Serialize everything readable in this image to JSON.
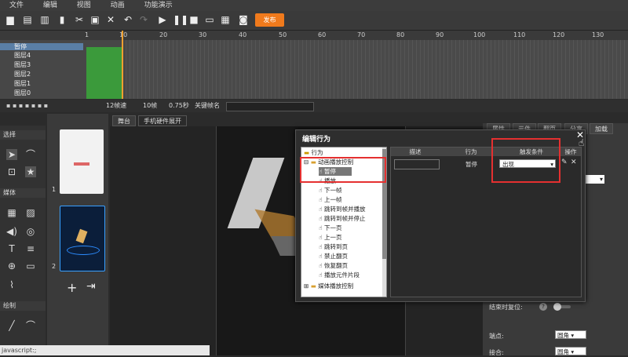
{
  "menu": [
    "文件",
    "编辑",
    "视图",
    "动画",
    "功能演示"
  ],
  "toolbar": {
    "publish_label": "发布"
  },
  "ruler": [
    "1",
    "10",
    "20",
    "30",
    "40",
    "50",
    "60",
    "70",
    "80",
    "90",
    "100",
    "110",
    "120",
    "130"
  ],
  "layers": [
    "暂停",
    "图层4",
    "图层3",
    "图层2",
    "图层1",
    "图层0"
  ],
  "timeline_status": {
    "fps": "12帧速",
    "frames": "10帧",
    "seconds": "0.75秒",
    "keyframe_label": "关键帧名"
  },
  "left_panel": {
    "select_header": "选择",
    "media_header": "媒体",
    "draw_header": "绘制"
  },
  "pages": {
    "page1_label": "1",
    "page2_label": "2"
  },
  "canvas_tabs": [
    "舞台",
    "手机硬件展开"
  ],
  "right_tabs": [
    "属性",
    "元件",
    "翻页",
    "分享",
    "加载"
  ],
  "dialog": {
    "title": "编辑行为",
    "tree_root": "行为",
    "tree_group": "动画播放控制",
    "tree_items": [
      "暂停",
      "播放",
      "下一帧",
      "上一帧",
      "跳转到帧并播放",
      "跳转到帧并停止",
      "下一页",
      "上一页",
      "跳转到页",
      "禁止翻页",
      "恢复翻页",
      "播放元件片段"
    ],
    "tree_group2": "媒体播放控制",
    "columns": [
      "描述",
      "行为",
      "触发条件",
      "操作"
    ],
    "row": {
      "description": "",
      "behavior": "暂停",
      "trigger": "出现"
    }
  },
  "properties": {
    "reset_label": "结束时复位:",
    "endpoint_label": "端点:",
    "endpoint_value": "圆角",
    "join_label": "接合:",
    "join_value": "圆角"
  },
  "status_text": "javascript:;"
}
